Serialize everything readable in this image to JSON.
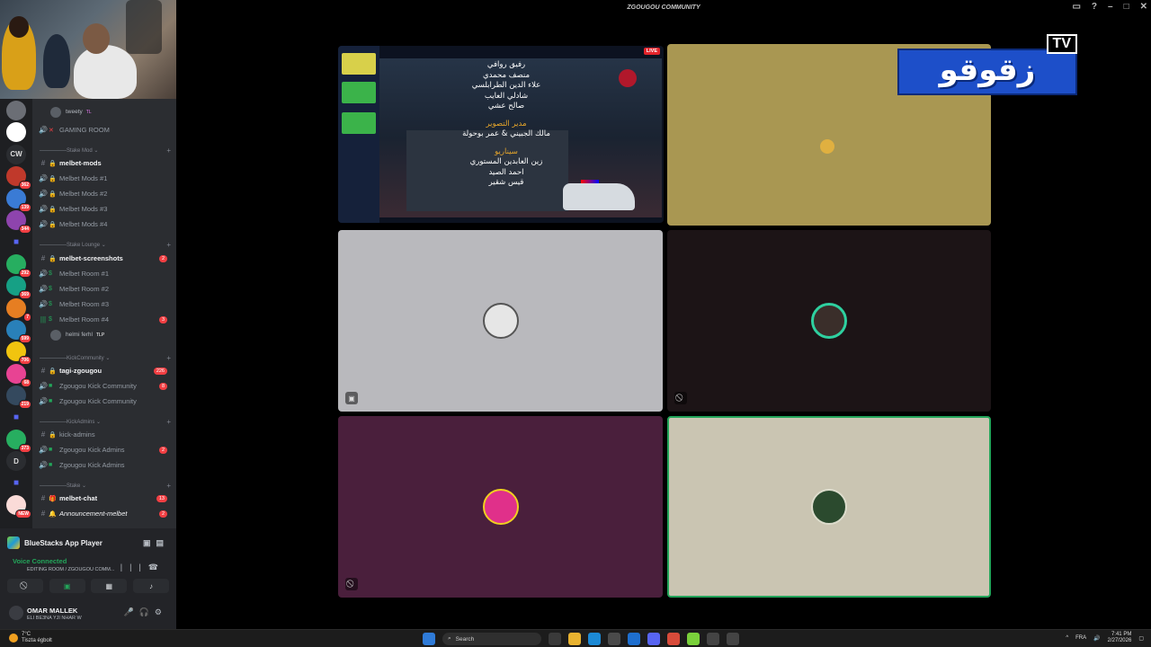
{
  "window": {
    "title": "ZGOUGOU COMMUNITY"
  },
  "rail": {
    "items": [
      {
        "label": "",
        "badge": ""
      },
      {
        "label": "",
        "badge": ""
      },
      {
        "label": "CW",
        "badge": ""
      },
      {
        "label": "",
        "badge": "362"
      },
      {
        "label": "",
        "badge": "139"
      },
      {
        "label": "",
        "badge": "344"
      },
      {
        "label": "",
        "badge": ""
      },
      {
        "label": "",
        "badge": "292"
      },
      {
        "label": "",
        "badge": "369"
      },
      {
        "label": "",
        "badge": "7"
      },
      {
        "label": "",
        "badge": "599"
      },
      {
        "label": "",
        "badge": "706"
      },
      {
        "label": "",
        "badge": "68"
      },
      {
        "label": "",
        "badge": "219"
      },
      {
        "label": "",
        "badge": ""
      },
      {
        "label": "",
        "badge": "373"
      },
      {
        "label": "D",
        "badge": ""
      },
      {
        "label": "",
        "badge": ""
      },
      {
        "label": "",
        "badge": "NEW"
      }
    ]
  },
  "channels": {
    "voice_user_tweety": "tweety",
    "voice_user_tweety_tag": "TL",
    "gaming_room": "GAMING ROOM",
    "cat_stake_mod": "Stake Mod",
    "melbet_mods": "melbet-mods",
    "melbet_mods_1": "Melbet Mods #1",
    "melbet_mods_2": "Melbet Mods #2",
    "melbet_mods_3": "Melbet Mods #3",
    "melbet_mods_4": "Melbet Mods #4",
    "cat_stake_lounge": "Stake Lounge",
    "melbet_screenshots": "melbet-screenshots",
    "melbet_screenshots_badge": "2",
    "melbet_room_1": "Melbet Room #1",
    "melbet_room_2": "Melbet Room #2",
    "melbet_room_3": "Melbet Room #3",
    "melbet_room_4": "Melbet Room #4",
    "melbet_room_4_badge": "3",
    "voice_user_helmi": "helmi ferhl",
    "voice_user_helmi_tag": "TLP",
    "cat_kick_community": "KickCommunity",
    "tagi_zgougou": "tagi-zgougou",
    "tagi_zgougou_badge": "226",
    "kick_community_1": "Zgougou Kick Community",
    "kick_community_1_badge": "8",
    "kick_community_2": "Zgougou Kick Community",
    "cat_kick_admins": "KickAdmins",
    "kick_admins": "kick-admins",
    "kick_admins_1": "Zgougou Kick Admins",
    "kick_admins_1_badge": "2",
    "kick_admins_2": "Zgougou Kick Admins",
    "cat_stake": "Stake",
    "melbet_chat": "melbet-chat",
    "melbet_chat_badge": "13",
    "announcement_melbet": "Announcement-melbet",
    "announcement_melbet_badge": "2"
  },
  "panel": {
    "app_activity": "BlueStacks App Player",
    "voice_status": "Voice Connected",
    "voice_location": "EDITING ROOM / ZGOUGOU COMM...",
    "username": "OMAR MALLEK",
    "user_status": "ELI BE3NA YJI NHAR W"
  },
  "stage": {
    "live_label": "LIVE",
    "credits": {
      "names_1": [
        "رفيق روافي",
        "منصف محمدي",
        "علاء الدين الطرابلسي",
        "شادلي العايب",
        "صالح عشي"
      ],
      "heading_2": "مدير التصوير",
      "names_2": [
        "مالك الجبيني & عمر بوحولة"
      ],
      "heading_3": "سيناريو",
      "names_3": [
        "زين العابدين المستوري",
        "احمد الصيد",
        "قيس شقير"
      ]
    }
  },
  "brand": {
    "text": "زقوقو",
    "tv": "TV"
  },
  "taskbar": {
    "temperature": "7°C",
    "weather": "Tiszta égbolt",
    "search": "Search",
    "lang": "FRA",
    "time": "7:41 PM",
    "date": "2/27/2026"
  },
  "colors": {
    "accent_green": "#23a55a",
    "badge_red": "#f23f43",
    "brand_blue": "#1d4fc9"
  }
}
